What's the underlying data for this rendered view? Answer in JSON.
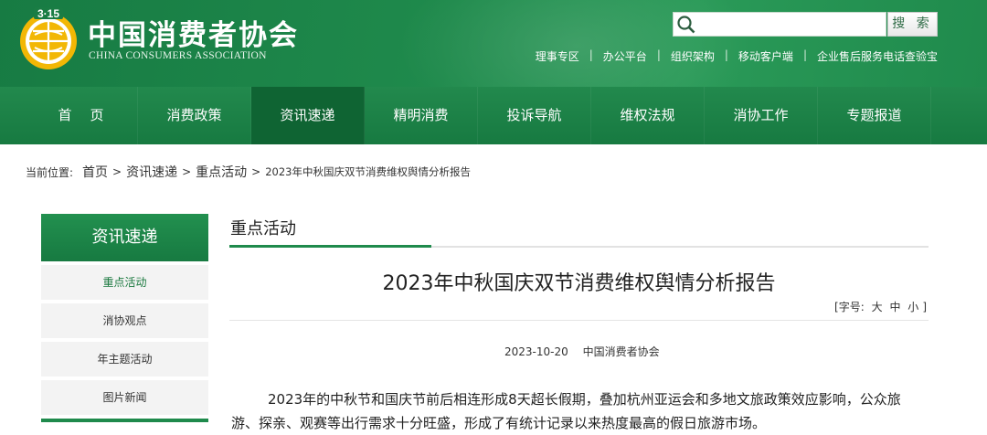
{
  "header": {
    "site_name": "中国消费者协会",
    "site_name_en": "CHINA CONSUMERS ASSOCIATION",
    "logo_text": "3·15",
    "search": {
      "value": "",
      "placeholder": "",
      "button_label": "搜 索"
    },
    "top_links": [
      "理事专区",
      "办公平台",
      "组织架构",
      "移动客户端",
      "企业售后服务电话查验宝"
    ]
  },
  "nav": {
    "items": [
      "首页",
      "消费政策",
      "资讯速递",
      "精明消费",
      "投诉导航",
      "维权法规",
      "消协工作",
      "专题报道"
    ],
    "active_index": 2
  },
  "breadcrumb": {
    "label": "当前位置:",
    "items": [
      "首页",
      "资讯速递",
      "重点活动"
    ],
    "current": "2023年中秋国庆双节消费维权舆情分析报告"
  },
  "sidebar": {
    "title": "资讯速递",
    "items": [
      "重点活动",
      "消协观点",
      "年主题活动",
      "图片新闻"
    ],
    "active_index": 0
  },
  "main": {
    "section_title": "重点活动",
    "article_title": "2023年中秋国庆双节消费维权舆情分析报告",
    "font_size": {
      "prefix": "[字号:",
      "large": "大",
      "medium": "中",
      "small": "小",
      "suffix": "]"
    },
    "date": "2023-10-20",
    "source": "中国消费者协会",
    "body": "2023年的中秋节和国庆节前后相连形成8天超长假期，叠加杭州亚运会和多地文旅政策效应影响，公众旅游、探亲、观赛等出行需求十分旺盛，形成了有统计记录以来热度最高的假日旅游市场。"
  },
  "colors": {
    "brand_green": "#1f8a4c",
    "nav_active": "#0f6433",
    "logo_gold": "#f2b705"
  }
}
